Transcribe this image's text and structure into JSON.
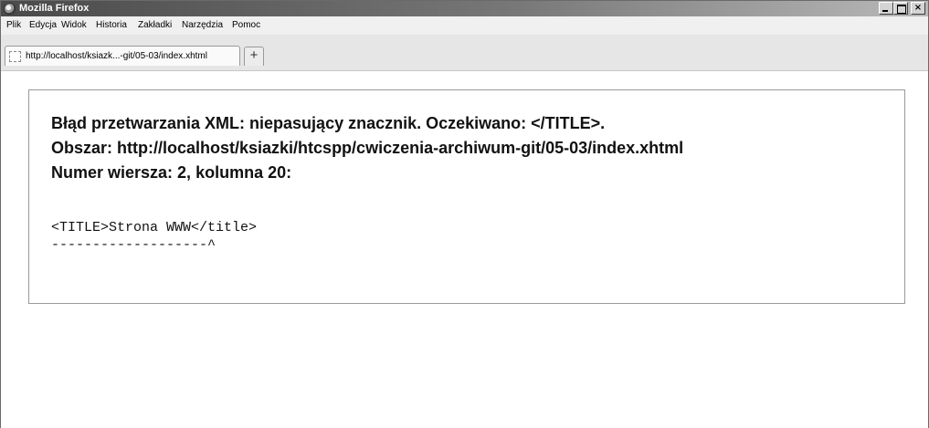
{
  "window": {
    "title": "Mozilla Firefox",
    "controls": {
      "minimize": "",
      "maximize": "",
      "close": "×"
    }
  },
  "menu": {
    "items": [
      "Plik",
      "Edycja",
      "Widok",
      "Historia",
      "Zakładki",
      "Narzędzia",
      "Pomoc"
    ]
  },
  "tabs": {
    "active_label": "http://localhost/ksiazk...-git/05-03/index.xhtml",
    "new_tab_label": "+"
  },
  "error": {
    "message_line1": "Błąd przetwarzania XML: niepasujący znacznik. Oczekiwano: </TITLE>.",
    "message_line2": "Obszar: http://localhost/ksiazki/htcspp/cwiczenia-archiwum-git/05-03/index.xhtml",
    "message_line3": "Numer wiersza: 2, kolumna 20:",
    "source_line": "<TITLE>Strona WWW</title>",
    "source_pointer": "-------------------^"
  }
}
